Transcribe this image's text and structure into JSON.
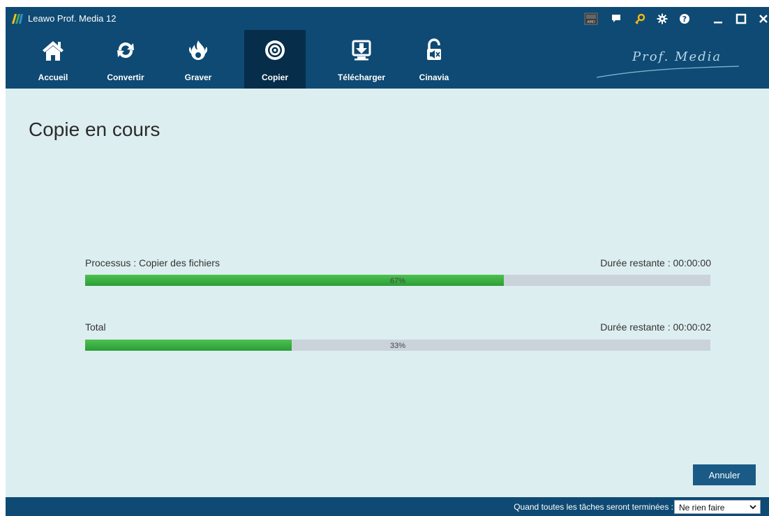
{
  "window": {
    "title": "Leawo Prof. Media 12",
    "icons": [
      "amd-icon",
      "feedback-icon",
      "key-icon",
      "settings-icon",
      "help-icon",
      "minimize-icon",
      "maximize-icon",
      "close-icon"
    ]
  },
  "nav": {
    "items": [
      {
        "label": "Accueil",
        "icon": "home-icon"
      },
      {
        "label": "Convertir",
        "icon": "convert-icon"
      },
      {
        "label": "Graver",
        "icon": "burn-icon"
      },
      {
        "label": "Copier",
        "icon": "copy-disc-icon",
        "active": true
      },
      {
        "label": "Télécharger",
        "icon": "download-icon"
      },
      {
        "label": "Cinavia",
        "icon": "cinavia-icon"
      }
    ],
    "brand": "Prof. Media"
  },
  "main": {
    "title": "Copie en cours",
    "tasks": [
      {
        "label": "Processus : Copier des fichiers",
        "remaining": "Durée restante : 00:00:00",
        "progress_text": "67%",
        "progress": 0.67
      },
      {
        "label": "Total",
        "remaining": "Durée restante : 00:00:02",
        "progress_text": "33%",
        "progress": 0.33
      }
    ],
    "cancel_label": "Annuler"
  },
  "footer": {
    "after_label": "Quand toutes les tâches seront terminées :",
    "after_value": "Ne rien faire"
  },
  "colors": {
    "header": "#0e4a73",
    "active_tab": "#062d4a",
    "background": "#ddeef0",
    "progress_fill": "#3db144",
    "progress_track": "#c9d3d9",
    "button": "#1a5a86"
  }
}
